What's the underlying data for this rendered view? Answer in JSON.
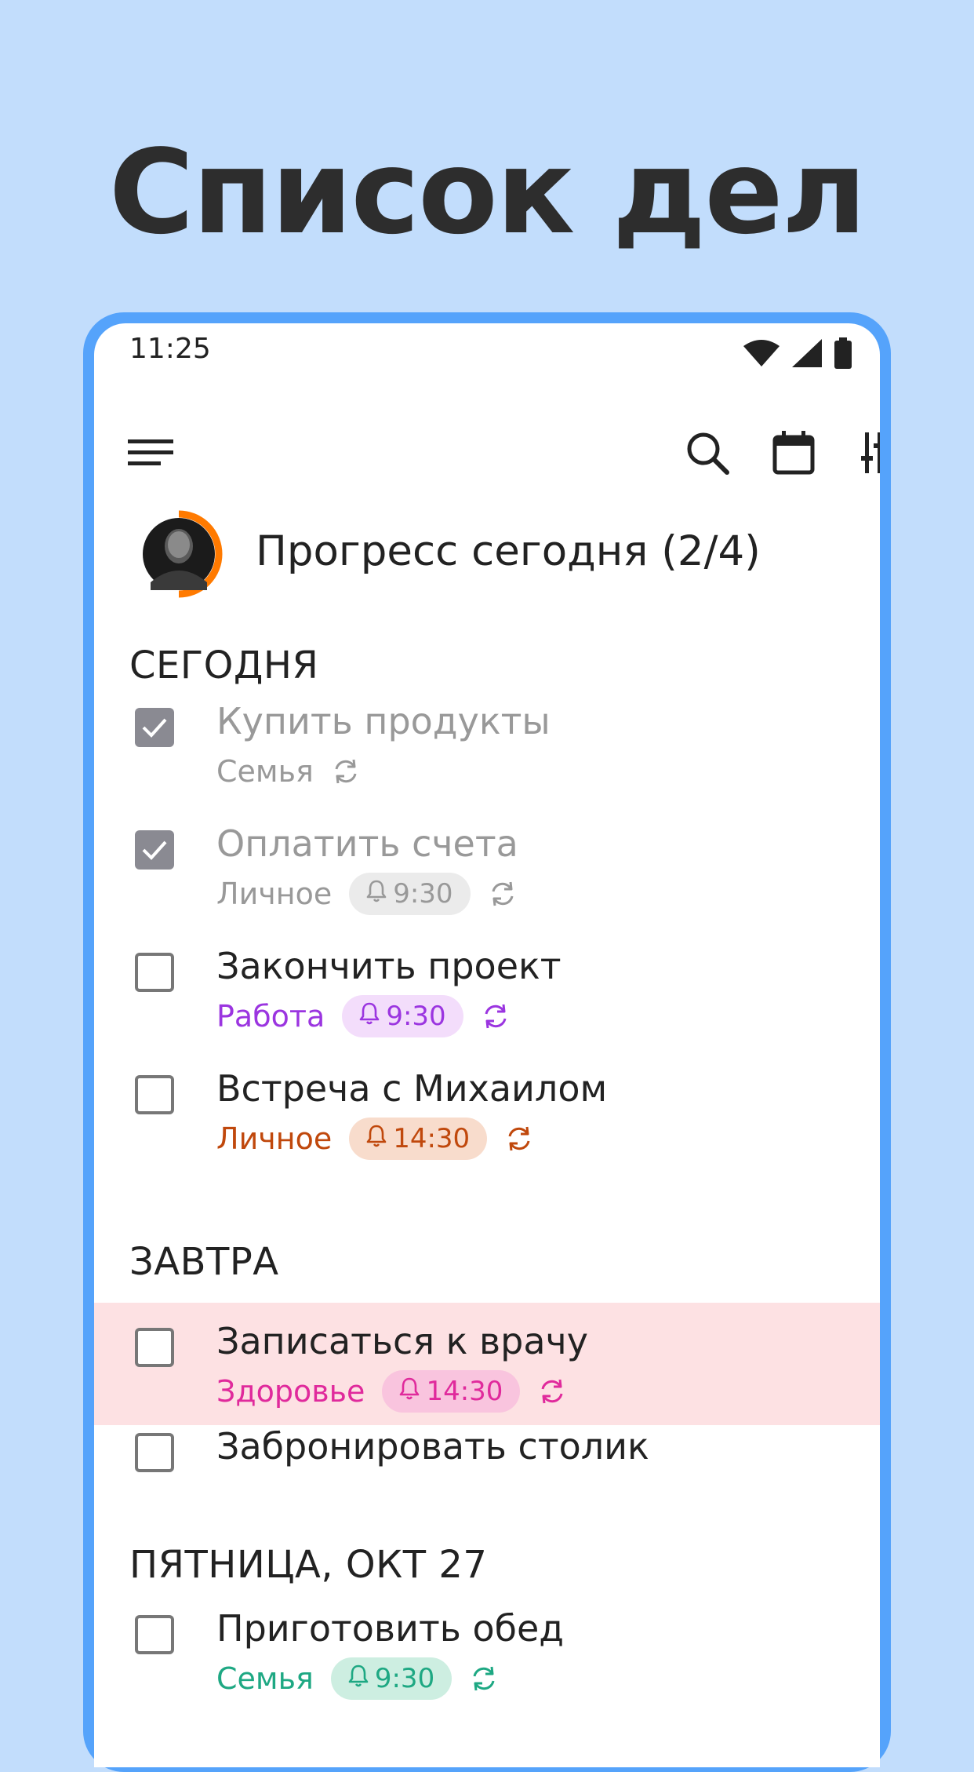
{
  "headline": "Список дел",
  "status": {
    "time": "11:25"
  },
  "appbar": {
    "icons": [
      "menu-icon",
      "search-icon",
      "calendar-icon",
      "filter-sliders-icon"
    ]
  },
  "progress": {
    "label": "Прогресс сегодня (2/4)",
    "done": 2,
    "total": 4,
    "ring_color": "#ff7a00"
  },
  "sections": {
    "today": "СЕГОДНЯ",
    "tomorrow": "ЗАВТРА",
    "friday": "ПЯТНИЦА, ОКТ 27"
  },
  "tasks": [
    {
      "title": "Купить продукты",
      "category": "Семья",
      "time": "",
      "repeat": true,
      "done": true,
      "color": "#999999"
    },
    {
      "title": "Оплатить счета",
      "category": "Личное",
      "time": "9:30",
      "repeat": true,
      "done": true,
      "color": "#999999",
      "pill_bg": "#ebebeb"
    },
    {
      "title": "Закончить проект",
      "category": "Работа",
      "time": "9:30",
      "repeat": true,
      "done": false,
      "color": "#9b35e0",
      "pill_bg": "#f3ddfb"
    },
    {
      "title": "Встреча с Михаилом",
      "category": "Личное",
      "time": "14:30",
      "repeat": true,
      "done": false,
      "color": "#c0480c",
      "pill_bg": "#f8dccc"
    },
    {
      "title": "Записаться к врачу",
      "category": "Здоровье",
      "time": "14:30",
      "repeat": true,
      "done": false,
      "color": "#e02a9c",
      "pill_bg": "#f9c4de"
    },
    {
      "title": "Забронировать столик",
      "category": "",
      "time": "",
      "repeat": false,
      "done": false
    },
    {
      "title": "Приготовить обед",
      "category": "Семья",
      "time": "9:30",
      "repeat": true,
      "done": false,
      "color": "#1ea883",
      "pill_bg": "#cdeee1"
    }
  ]
}
